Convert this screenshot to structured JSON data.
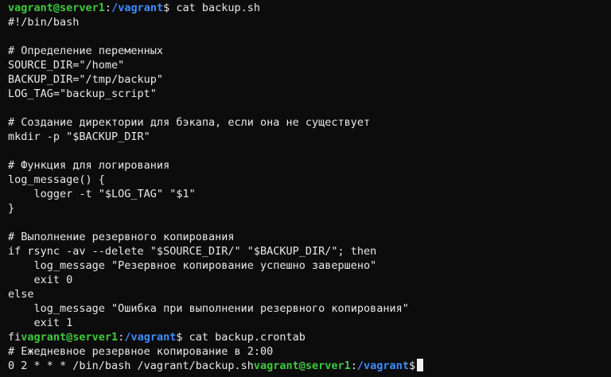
{
  "prompt": {
    "user_host": "vagrant@server1",
    "colon": ":",
    "path": "/vagrant",
    "symbol": "$"
  },
  "commands": {
    "first": " cat backup.sh",
    "second": " cat backup.crontab"
  },
  "file_lines": [
    "#!/bin/bash",
    "",
    "# Определение переменных",
    "SOURCE_DIR=\"/home\"",
    "BACKUP_DIR=\"/tmp/backup\"",
    "LOG_TAG=\"backup_script\"",
    "",
    "# Создание директории для бэкапа, если она не существует",
    "mkdir -p \"$BACKUP_DIR\"",
    "",
    "# Функция для логирования",
    "log_message() {",
    "    logger -t \"$LOG_TAG\" \"$1\"",
    "}",
    "",
    "# Выполнение резервного копирования",
    "if rsync -av --delete \"$SOURCE_DIR/\" \"$BACKUP_DIR/\"; then",
    "    log_message \"Резервное копирование успешно завершено\"",
    "    exit 0",
    "else",
    "    log_message \"Ошибка при выполнении резервного копирования\"",
    "    exit 1"
  ],
  "file_tail": "fi",
  "crontab_lines": [
    "# Ежедневное резервное копирование в 2:00"
  ],
  "crontab_tail": "0 2 * * * /bin/bash /vagrant/backup.sh",
  "colors": {
    "background": "#0c0c0c",
    "user_host": "#3ec93e",
    "path": "#3d8cff",
    "text": "#e8e8e8"
  }
}
